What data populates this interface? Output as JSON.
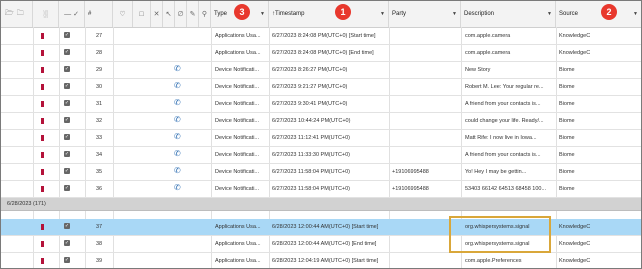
{
  "header": {
    "columns": {
      "num": "#",
      "type": "Type",
      "timestamp": "Timestamp",
      "party": "Party",
      "description": "Description",
      "source": "Source"
    },
    "badges": [
      "3",
      "1",
      "2"
    ]
  },
  "group": {
    "label": "6/28/2023 (171)"
  },
  "rows": [
    {
      "num": "27",
      "type": "Applications Usa...",
      "timestamp": "6/27/2023 8:24:08 PM(UTC+0) [Start time]",
      "party": "",
      "description": "com.apple.camera",
      "source": "KnowledgeC",
      "phone": false
    },
    {
      "num": "28",
      "type": "Applications Usa...",
      "timestamp": "6/27/2023 8:24:08 PM(UTC+0) [End time]",
      "party": "",
      "description": "com.apple.camera",
      "source": "KnowledgeC",
      "phone": false
    },
    {
      "num": "29",
      "type": "Device Notificati...",
      "timestamp": "6/27/2023 8:26:27 PM(UTC+0)",
      "party": "",
      "description": "New Story",
      "source": "Biome",
      "phone": true
    },
    {
      "num": "30",
      "type": "Device Notificati...",
      "timestamp": "6/27/2023 9:21:27 PM(UTC+0)",
      "party": "",
      "description": "Robert M. Lee: Your regular re...",
      "source": "Biome",
      "phone": true
    },
    {
      "num": "31",
      "type": "Device Notificati...",
      "timestamp": "6/27/2023 9:30:41 PM(UTC+0)",
      "party": "",
      "description": "A friend from your contacts is...",
      "source": "Biome",
      "phone": true
    },
    {
      "num": "32",
      "type": "Device Notificati...",
      "timestamp": "6/27/2023 10:44:24 PM(UTC+0)",
      "party": "",
      "description": "could change your life. Ready/...",
      "source": "Biome",
      "phone": true
    },
    {
      "num": "33",
      "type": "Device Notificati...",
      "timestamp": "6/27/2023 11:12:41 PM(UTC+0)",
      "party": "",
      "description": "Matt Rife: I now live in Iowa...",
      "source": "Biome",
      "phone": true
    },
    {
      "num": "34",
      "type": "Device Notificati...",
      "timestamp": "6/27/2023 11:33:30 PM(UTC+0)",
      "party": "",
      "description": "A friend from your contacts is...",
      "source": "Biome",
      "phone": true
    },
    {
      "num": "35",
      "type": "Device Notificati...",
      "timestamp": "6/27/2023 11:58:04 PM(UTC+0)",
      "party": "+19106995488",
      "description": "Yo! Hey I may be gettin...",
      "source": "Biome",
      "phone": true
    },
    {
      "num": "36",
      "type": "Device Notificati...",
      "timestamp": "6/27/2023 11:58:04 PM(UTC+0)",
      "party": "+19106995488",
      "description": "53403 66142 64513 68458 100...",
      "source": "Biome",
      "phone": true
    },
    {
      "num": "37",
      "type": "Applications Usa...",
      "timestamp": "6/28/2023 12:00:44 AM(UTC+0) [Start time]",
      "party": "",
      "description": "org.whispersystems.signal",
      "source": "KnowledgeC",
      "phone": false
    },
    {
      "num": "38",
      "type": "Applications Usa...",
      "timestamp": "6/28/2023 12:00:44 AM(UTC+0) [End time]",
      "party": "",
      "description": "org.whispersystems.signal",
      "source": "KnowledgeC",
      "phone": false
    },
    {
      "num": "39",
      "type": "Applications Usa...",
      "timestamp": "6/28/2023 12:04:19 AM(UTC+0) [Start time]",
      "party": "",
      "description": "com.apple.Preferences",
      "source": "KnowledgeC",
      "phone": false
    }
  ],
  "colors": {
    "selected_row": "#a9d8f6",
    "badge": "#e8382d",
    "highlight": "#d9a73a",
    "flag": "#b4123a"
  },
  "icons": [
    "folder-open-icon",
    "folder-icon",
    "column-chart-icon",
    "minus-icon",
    "checkmark-icon",
    "tag-icon",
    "comment-icon",
    "close-icon",
    "cursor-icon",
    "attachment-icon",
    "edit-icon",
    "location-pin-icon",
    "phone-icon",
    "sort-icon",
    "dropdown-icon"
  ]
}
